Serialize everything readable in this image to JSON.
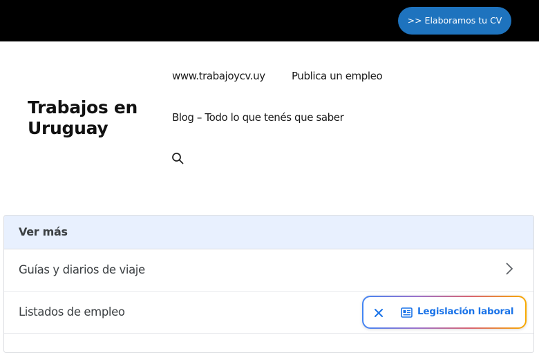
{
  "topbar": {
    "cta_label": ">> Elaboramos tu CV"
  },
  "site": {
    "title": "Trabajos en Uruguay"
  },
  "nav": {
    "items": [
      {
        "label": "www.trabajoycv.uy"
      },
      {
        "label": "Publica un empleo"
      },
      {
        "label": "Blog – Todo lo que tenés que saber"
      }
    ],
    "search_icon": "search-icon"
  },
  "panel": {
    "header": "Ver más",
    "rows": [
      {
        "label": "Guías y diarios de viaje"
      },
      {
        "label": "Listados de empleo"
      }
    ]
  },
  "chip": {
    "label": "Legislación laboral",
    "close_icon": "close-icon",
    "doc_icon": "document-icon"
  },
  "colors": {
    "topbar": "#000000",
    "cta": "#1e73be",
    "panel_header": "#e8f0fe",
    "chip_text": "#1a73e8"
  }
}
